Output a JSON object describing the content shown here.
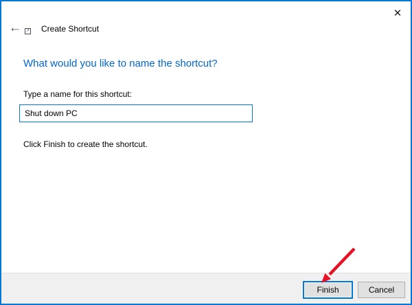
{
  "window": {
    "titlebar": {
      "close_icon": "✕"
    }
  },
  "nav": {
    "back_icon": "←",
    "shortcut_overlay_icon": "↗",
    "title": "Create Shortcut"
  },
  "content": {
    "heading": "What would you like to name the shortcut?",
    "field_label": "Type a name for this shortcut:",
    "field_value": "Shut down PC",
    "instruction": "Click Finish to create the shortcut."
  },
  "footer": {
    "finish_label": "Finish",
    "cancel_label": "Cancel"
  },
  "annotation": {
    "type": "red-arrow",
    "target": "finish-button",
    "color": "#e81123"
  },
  "colors": {
    "accent_border": "#0078d7",
    "heading_text": "#0066cc",
    "footer_bg": "#f0f0f0",
    "divider": "#dfdfdf",
    "button_face": "#e1e1e1",
    "button_border": "#adadad"
  }
}
